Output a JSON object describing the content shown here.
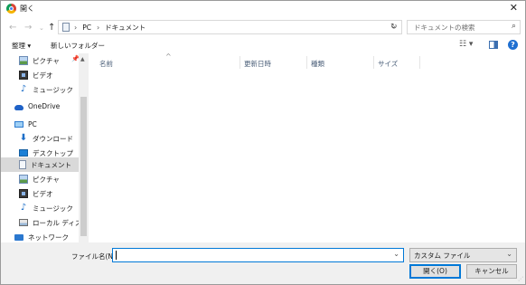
{
  "window": {
    "title": "開く"
  },
  "address": {
    "crumbs": [
      "PC",
      "ドキュメント"
    ],
    "search_placeholder": "ドキュメントの検索"
  },
  "toolbar": {
    "organize": "整理 ▾",
    "new_folder": "新しいフォルダー"
  },
  "sidebar": {
    "items": [
      {
        "label": "ピクチャ",
        "icon": "picture-icon"
      },
      {
        "label": "ビデオ",
        "icon": "video-icon"
      },
      {
        "label": "ミュージック",
        "icon": "music-icon"
      },
      {
        "label": "OneDrive",
        "icon": "cloud-icon"
      },
      {
        "label": "PC",
        "icon": "computer-icon"
      },
      {
        "label": "ダウンロード",
        "icon": "download-icon"
      },
      {
        "label": "デスクトップ",
        "icon": "desktop-icon"
      },
      {
        "label": "ドキュメント",
        "icon": "document-icon"
      },
      {
        "label": "ピクチャ",
        "icon": "picture-icon"
      },
      {
        "label": "ビデオ",
        "icon": "video-icon"
      },
      {
        "label": "ミュージック",
        "icon": "music-icon"
      },
      {
        "label": "ローカル ディスク (C",
        "icon": "drive-icon"
      },
      {
        "label": "ネットワーク",
        "icon": "network-icon"
      }
    ]
  },
  "columns": [
    "名前",
    "更新日時",
    "種類",
    "サイズ"
  ],
  "bottom": {
    "filename_label": "ファイル名(N):",
    "filename_value": "",
    "filetype": "カスタム ファイル",
    "open_button": "開く(O)",
    "cancel_button": "キャンセル"
  }
}
